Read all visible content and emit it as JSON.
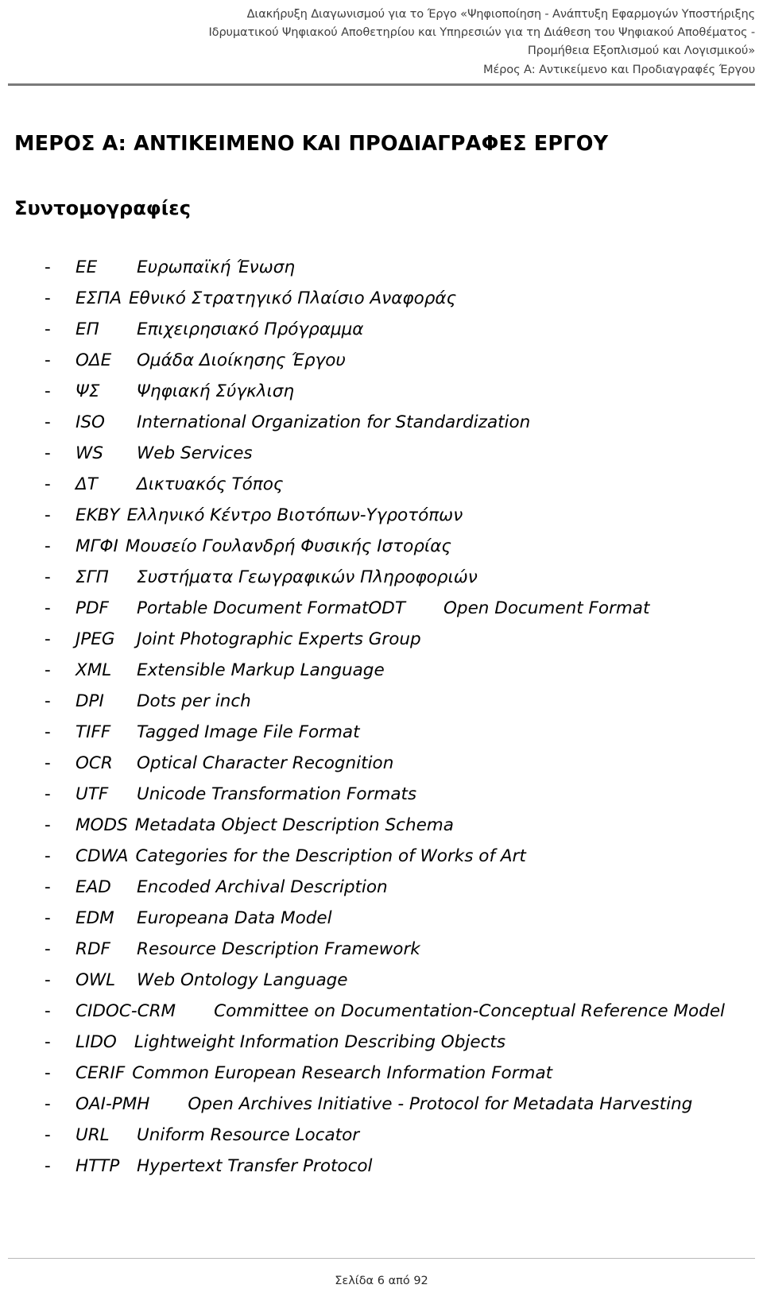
{
  "header": {
    "lines": [
      "Διακήρυξη Διαγωνισμού για το Έργο «Ψηφιοποίηση - Ανάπτυξη Εφαρμογών Υποστήριξης",
      "Ιδρυματικού Ψηφιακού Αποθετηρίου και Υπηρεσιών για τη Διάθεση του Ψηφιακού Αποθέματος -",
      "Προμήθεια Εξοπλισμού και Λογισμικού»",
      "Μέρος Α: Αντικείμενο και Προδιαγραφές Έργου"
    ],
    "rule_color": "#7a7a7a",
    "text_color": "#3f3f3f"
  },
  "body": {
    "doc_title": "ΜΕΡΟΣ Α: ΑΝΤΙΚΕΙΜΕΝΟ ΚΑΙ ΠΡΟΔΙΑΓΡΑΦΕΣ ΕΡΓΟΥ",
    "section_title": "Συντομογραφίες",
    "bullet": "-"
  },
  "abbreviations": [
    {
      "key": "ΕΕ",
      "value": "Ευρωπαϊκή Ένωση"
    },
    {
      "key": "ΕΣΠΑ",
      "value": "Εθνικό Στρατηγικό Πλαίσιο Αναφοράς"
    },
    {
      "key": "ΕΠ",
      "value": "Επιχειρησιακό Πρόγραμμα"
    },
    {
      "key": "ΟΔΕ",
      "value": "Ομάδα Διοίκησης Έργου"
    },
    {
      "key": "ΨΣ",
      "value": "Ψηφιακή Σύγκλιση"
    },
    {
      "key": "ISO",
      "value": "International Organization for Standardization"
    },
    {
      "key": "WS",
      "value": "Web Services"
    },
    {
      "key": "ΔΤ",
      "value": "Δικτυακός Τόπος"
    },
    {
      "key": "ΕΚΒΥ",
      "value": "Ελληνικό Κέντρο Βιοτόπων-Υγροτόπων"
    },
    {
      "key": "ΜΓΦΙ",
      "value": "Μουσείο Γουλανδρή Φυσικής Ιστορίας"
    },
    {
      "key": "ΣΓΠ",
      "value": "Συστήματα Γεωγραφικών Πληροφοριών"
    },
    {
      "key": "PDF",
      "value": "Portable Document FormatODT",
      "value_extra": "Open Document Format"
    },
    {
      "key": "JPEG",
      "value": "Joint Photographic Experts Group"
    },
    {
      "key": "XML",
      "value": "Extensible Markup Language"
    },
    {
      "key": "DPI",
      "value": "Dots per inch"
    },
    {
      "key": "TIFF",
      "value": "Tagged Image File Format"
    },
    {
      "key": "OCR",
      "value": "Optical Character Recognition"
    },
    {
      "key": "UTF",
      "value": "Unicode Transformation Formats"
    },
    {
      "key": "MODS",
      "value": "Metadata Object Description Schema"
    },
    {
      "key": "CDWA",
      "value": "Categories for the Description of Works of Art"
    },
    {
      "key": "EAD",
      "value": "Encoded Archival Description"
    },
    {
      "key": "EDM",
      "value": "Europeana Data Model"
    },
    {
      "key": "RDF",
      "value": "Resource Description Framework"
    },
    {
      "key": "OWL",
      "value": "Web Ontology Language"
    },
    {
      "key": "CIDOC-CRM",
      "value": "Committee on Documentation-Conceptual Reference Model"
    },
    {
      "key": "LIDO",
      "value": "Lightweight Information Describing Objects"
    },
    {
      "key": "CERIF",
      "value": "Common European Research Information Format"
    },
    {
      "key": "OAI-PMH",
      "value": "Open Archives Initiative - Protocol for Metadata Harvesting"
    },
    {
      "key": "URL",
      "value": "Uniform Resource Locator"
    },
    {
      "key": "HTTP",
      "value": "Hypertext Transfer Protocol"
    }
  ],
  "footer": {
    "page_label": "Σελίδα 6 από 92"
  }
}
